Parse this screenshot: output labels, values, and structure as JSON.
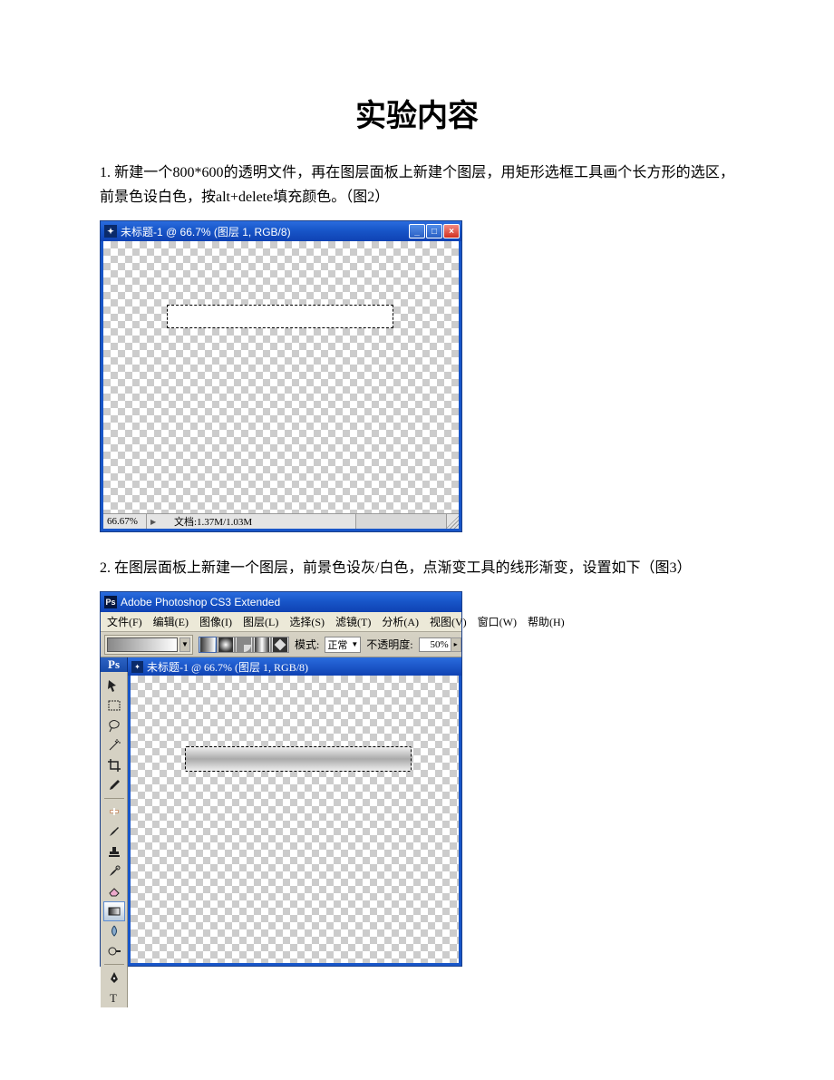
{
  "title": "实验内容",
  "para1": "1.  新建一个800*600的透明文件，再在图层面板上新建个图层，用矩形选框工具画个长方形的选区，前景色设白色，按alt+delete填充颜色。（图2）",
  "para2": "2.  在图层面板上新建一个图层，前景色设灰/白色，点渐变工具的线形渐变，设置如下（图3）",
  "fig1": {
    "title": "未标题-1 @ 66.7% (图层 1, RGB/8)",
    "zoom": "66.67%",
    "docinfo": "文档:1.37M/1.03M"
  },
  "fig2": {
    "appTitle": "Adobe Photoshop CS3 Extended",
    "menu": [
      "文件(F)",
      "编辑(E)",
      "图像(I)",
      "图层(L)",
      "选择(S)",
      "滤镜(T)",
      "分析(A)",
      "视图(V)",
      "窗口(W)",
      "帮助(H)"
    ],
    "optionsBar": {
      "modeLabel": "模式:",
      "modeValue": "正常",
      "opacityLabel": "不透明度:",
      "opacityValue": "50%"
    },
    "docTitle": "未标题-1 @ 66.7% (图层 1, RGB/8)",
    "psBadge": "Ps",
    "tools": [
      "move",
      "marquee",
      "lasso",
      "wand",
      "crop",
      "eyedropper",
      "healing",
      "brush",
      "stamp",
      "history-brush",
      "eraser",
      "gradient",
      "blur",
      "dodge",
      "pen",
      "type"
    ]
  }
}
